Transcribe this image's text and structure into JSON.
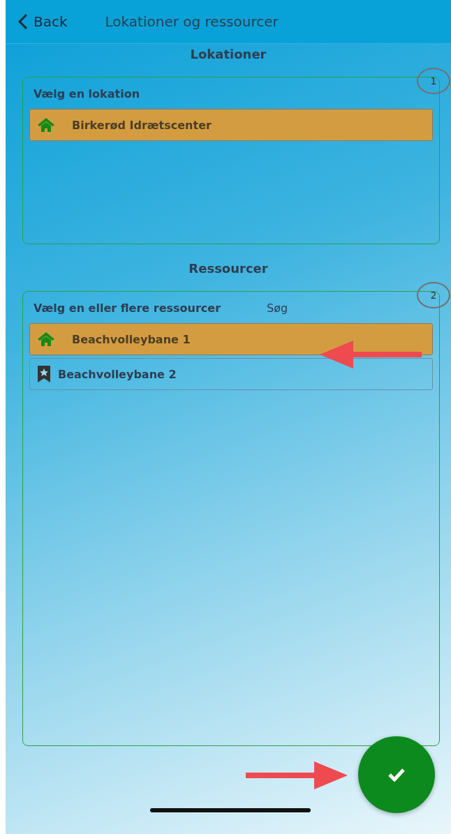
{
  "header": {
    "back": "Back",
    "title": "Lokationer og ressourcer"
  },
  "sections": [
    {
      "title": "Lokationer",
      "prompt": "Vælg en lokation",
      "annotation": "1",
      "items": [
        {
          "kind": "home",
          "label": "Birkerød Idrætscenter",
          "selected": true
        }
      ]
    },
    {
      "title": "Ressourcer",
      "prompt": "Vælg en eller flere ressourcer",
      "search": "Søg",
      "annotation": "2",
      "items": [
        {
          "kind": "home",
          "label": "Beachvolleybane 1",
          "selected": true
        },
        {
          "kind": "bookmark",
          "label": "Beachvolleybane 2",
          "selected": false
        }
      ]
    }
  ]
}
